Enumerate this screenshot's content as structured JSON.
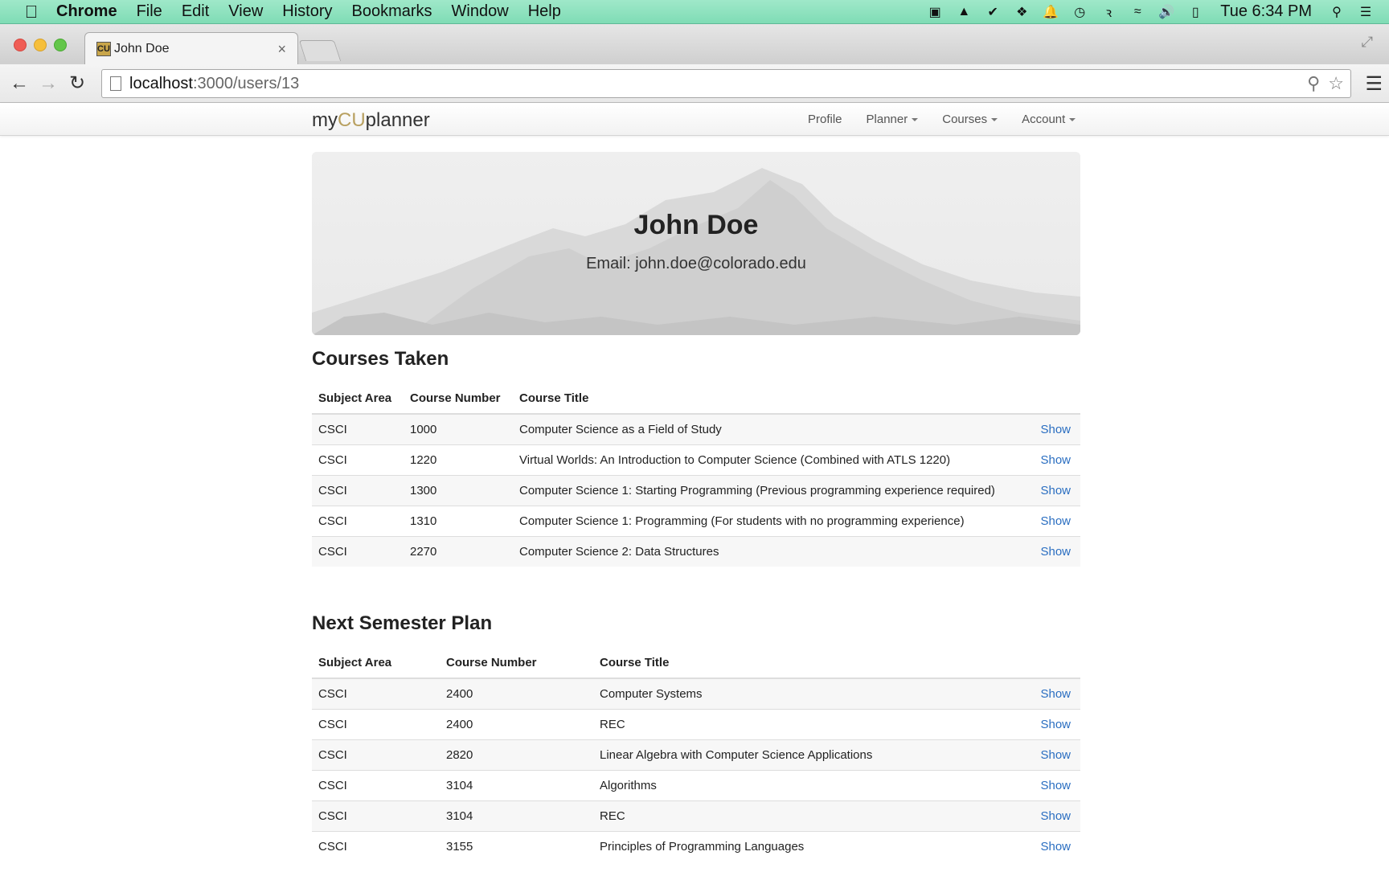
{
  "menubar": {
    "app": "Chrome",
    "items": [
      "File",
      "Edit",
      "View",
      "History",
      "Bookmarks",
      "Window",
      "Help"
    ],
    "clock": "Tue 6:34 PM"
  },
  "browser": {
    "tab_title": "John Doe",
    "url_host": "localhost",
    "url_path": ":3000/users/13"
  },
  "site": {
    "brand_pre": "my",
    "brand_cu": "CU",
    "brand_post": "planner",
    "nav": {
      "profile": "Profile",
      "planner": "Planner",
      "courses": "Courses",
      "account": "Account"
    }
  },
  "profile": {
    "name": "John Doe",
    "email_line": "Email: john.doe@colorado.edu"
  },
  "courses_taken": {
    "title": "Courses Taken",
    "headers": [
      "Subject Area",
      "Course Number",
      "Course Title"
    ],
    "rows": [
      {
        "subject": "CSCI",
        "number": "1000",
        "title": "Computer Science as a Field of Study",
        "action": "Show"
      },
      {
        "subject": "CSCI",
        "number": "1220",
        "title": "Virtual Worlds: An Introduction to Computer Science (Combined with ATLS 1220)",
        "action": "Show"
      },
      {
        "subject": "CSCI",
        "number": "1300",
        "title": "Computer Science 1: Starting Programming (Previous programming experience required)",
        "action": "Show"
      },
      {
        "subject": "CSCI",
        "number": "1310",
        "title": "Computer Science 1: Programming (For students with no programming experience)",
        "action": "Show"
      },
      {
        "subject": "CSCI",
        "number": "2270",
        "title": "Computer Science 2: Data Structures",
        "action": "Show"
      }
    ]
  },
  "next_semester": {
    "title": "Next Semester Plan",
    "headers": [
      "Subject Area",
      "Course Number",
      "Course Title"
    ],
    "rows": [
      {
        "subject": "CSCI",
        "number": "2400",
        "title": "Computer Systems",
        "action": "Show"
      },
      {
        "subject": "CSCI",
        "number": "2400",
        "title": "REC",
        "action": "Show"
      },
      {
        "subject": "CSCI",
        "number": "2820",
        "title": "Linear Algebra with Computer Science Applications",
        "action": "Show"
      },
      {
        "subject": "CSCI",
        "number": "3104",
        "title": "Algorithms",
        "action": "Show"
      },
      {
        "subject": "CSCI",
        "number": "3104",
        "title": "REC",
        "action": "Show"
      },
      {
        "subject": "CSCI",
        "number": "3155",
        "title": "Principles of Programming Languages",
        "action": "Show"
      }
    ]
  },
  "colors": {
    "menubar": "#8fe2bf",
    "brand_accent": "#b8a060",
    "link": "#2a6ec1"
  }
}
